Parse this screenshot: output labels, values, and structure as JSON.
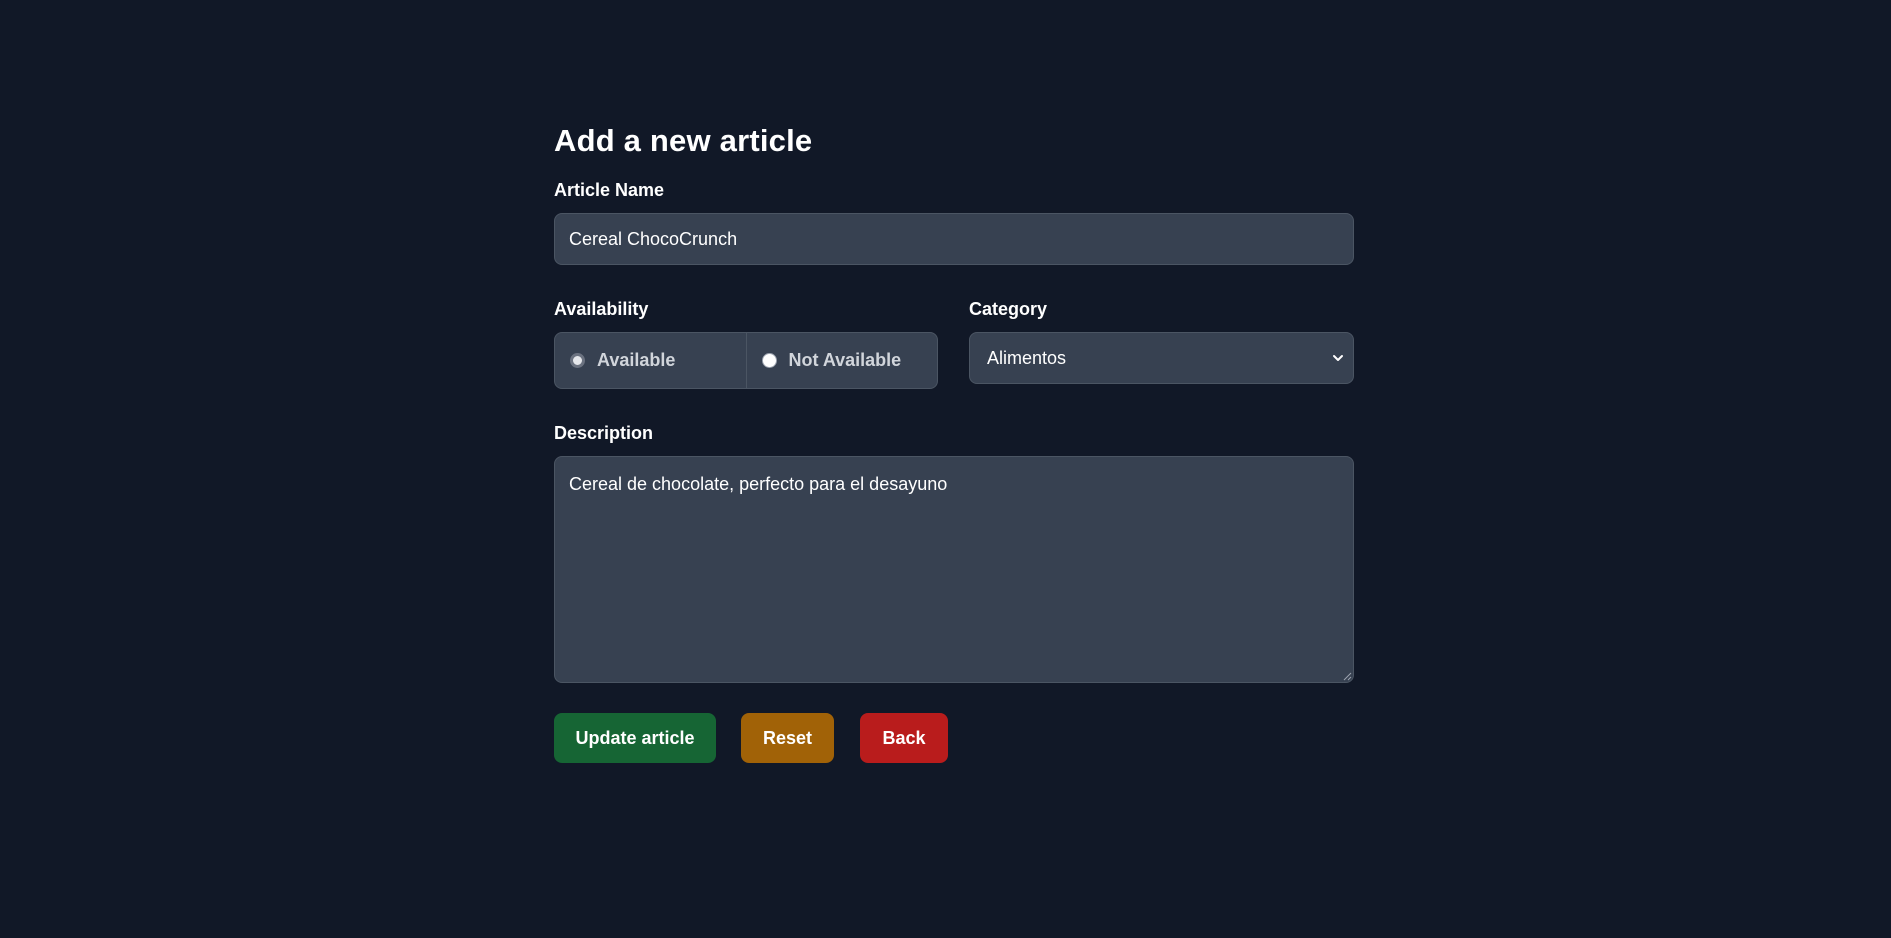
{
  "page": {
    "title": "Add a new article"
  },
  "form": {
    "article_name": {
      "label": "Article Name",
      "value": "Cereal ChocoCrunch"
    },
    "availability": {
      "label": "Availability",
      "options": [
        {
          "label": "Available",
          "checked": true
        },
        {
          "label": "Not Available",
          "checked": false
        }
      ]
    },
    "category": {
      "label": "Category",
      "selected": "Alimentos"
    },
    "description": {
      "label": "Description",
      "value": "Cereal de chocolate, perfecto para el desayuno"
    }
  },
  "buttons": {
    "update": {
      "label": "Update article",
      "color": "#166534"
    },
    "reset": {
      "label": "Reset",
      "color": "#a16207"
    },
    "back": {
      "label": "Back",
      "color": "#b91c1c"
    }
  },
  "colors": {
    "background": "#111827",
    "field": "#374151",
    "border": "#4b5563"
  },
  "icons": {
    "select_arrow": "chevron-down-icon"
  }
}
